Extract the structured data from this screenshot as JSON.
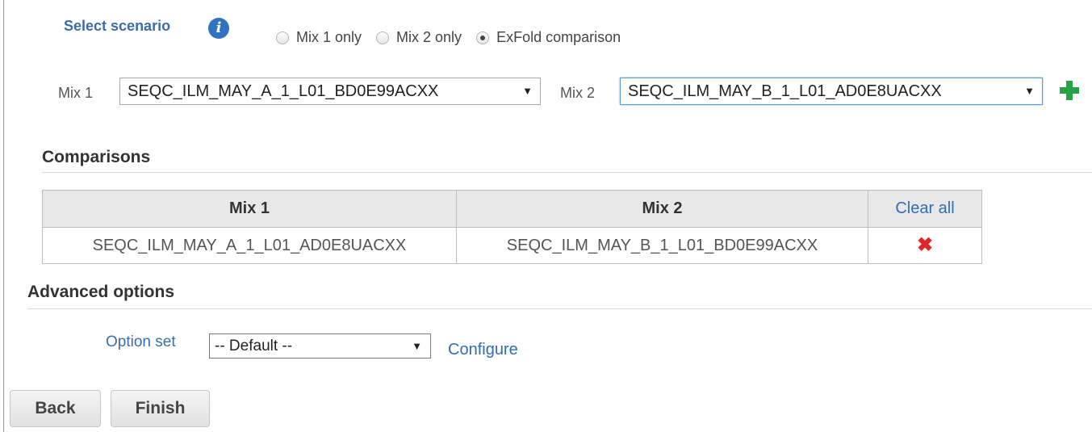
{
  "scenario": {
    "label": "Select scenario",
    "info_glyph": "i",
    "options": [
      {
        "label": "Mix 1 only",
        "checked": false
      },
      {
        "label": "Mix 2 only",
        "checked": false
      },
      {
        "label": "ExFold comparison",
        "checked": true
      }
    ]
  },
  "mix_selection": {
    "mix1_label": "Mix 1",
    "mix1_value": "SEQC_ILM_MAY_A_1_L01_BD0E99ACXX",
    "mix2_label": "Mix 2",
    "mix2_value": "SEQC_ILM_MAY_B_1_L01_AD0E8UACXX",
    "caret": "▼"
  },
  "comparisons": {
    "title": "Comparisons",
    "headers": [
      "Mix 1",
      "Mix 2"
    ],
    "clear_all_label": "Clear all",
    "rows": [
      {
        "mix1": "SEQC_ILM_MAY_A_1_L01_AD0E8UACXX",
        "mix2": "SEQC_ILM_MAY_B_1_L01_BD0E99ACXX",
        "remove_glyph": "✖"
      }
    ]
  },
  "advanced": {
    "title": "Advanced options",
    "option_set_label": "Option set",
    "option_set_value": "-- Default --",
    "caret": "▼",
    "configure_label": "Configure"
  },
  "footer": {
    "back_label": "Back",
    "finish_label": "Finish"
  },
  "colors": {
    "link": "#2f6db5",
    "label_blue": "#3b6ea5",
    "info_icon": "#2f74c0",
    "add_icon": "#27a346",
    "remove_icon": "#e0252a",
    "header_bg": "#e8e8e8"
  },
  "icons": {
    "info": "info-icon",
    "add": "plus-icon",
    "remove": "close-icon"
  }
}
